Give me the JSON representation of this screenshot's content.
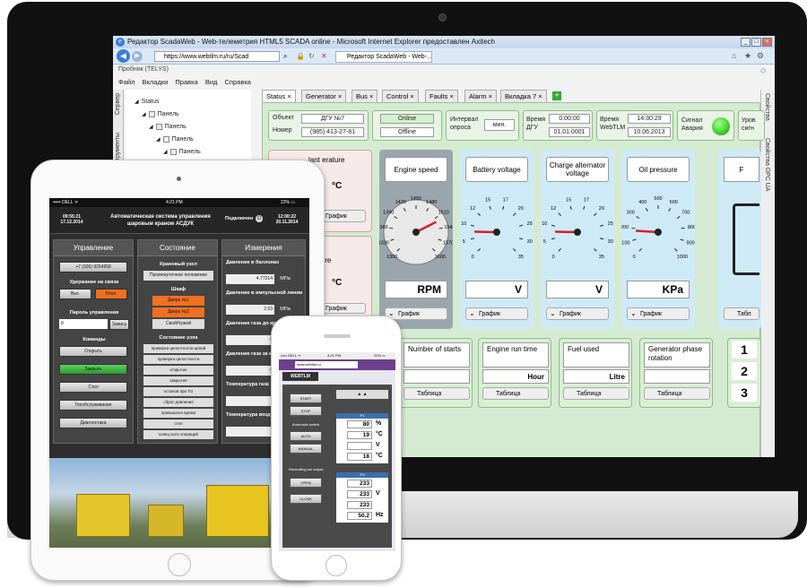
{
  "ie": {
    "title": "Редактор ScadaWeb - Web-телеметрия HTML5 SCADA online - Microsoft Internet Explorer предоставлен Axitech",
    "url": "https://www.webtlm.ru/ru/Scad",
    "tab_title": "Редактор ScadaWeb - Web-...",
    "app_name": "Пробник (TELYS)",
    "menu": [
      "Файл",
      "Вкладки",
      "Правка",
      "Вид",
      "Справка"
    ]
  },
  "sidebar": {
    "tabs": [
      "Сервер",
      "Инструменты"
    ]
  },
  "tree": [
    {
      "label": "Status"
    },
    {
      "label": "Панель"
    },
    {
      "label": "Панель"
    },
    {
      "label": "Панель"
    },
    {
      "label": "Панель"
    }
  ],
  "tabs": [
    {
      "label": "Status",
      "active": true
    },
    {
      "label": "Generator"
    },
    {
      "label": "Bus"
    },
    {
      "label": "Control"
    },
    {
      "label": "Faults"
    },
    {
      "label": "Alarm"
    },
    {
      "label": "Вкладка 7"
    }
  ],
  "right_tabs": [
    "Свойства",
    "Свойства OPC UA"
  ],
  "header": {
    "object_label": "Объект",
    "object_value": "ДГУ №7",
    "number_label": "Номер",
    "number_value": "(985) 413-27-81",
    "online": "Online",
    "offline": "Offline",
    "interval_label": "Интервал опроса",
    "interval_value": "мин.",
    "dgu_time_label": "Время ДГУ",
    "dgu_time": "0:00:00",
    "dgu_date": "01.01.0001",
    "webtlm_label": "Время WebTLM",
    "webtlm_time": "14:30:29",
    "webtlm_date": "10.06.2013",
    "alarm_label": "Сигнал Авария",
    "level_label": "Уров сигн"
  },
  "left_panels": [
    {
      "title": "lant erature",
      "unit": "°C",
      "button": "График"
    },
    {
      "title": "erature",
      "unit": "°C",
      "button": "График"
    }
  ],
  "gauges": [
    {
      "title": "Engine speed",
      "unit": "RPM",
      "button": "График",
      "ticks": [
        "1300",
        "1330",
        "1360",
        "1390",
        "1420",
        "1450",
        "1480",
        "1510",
        "1540",
        "1570",
        "1600"
      ],
      "value": 1520
    },
    {
      "title": "Battery voltage",
      "unit": "V",
      "button": "График",
      "ticks": [
        "0",
        "5",
        "10",
        "12",
        "15",
        "17",
        "20",
        "25",
        "30",
        "35"
      ],
      "value": 6
    },
    {
      "title": "Charge alternator voltage",
      "unit": "V",
      "button": "График",
      "ticks": [
        "0",
        "5",
        "10",
        "12",
        "15",
        "17",
        "20",
        "25",
        "30",
        "35"
      ],
      "value": 6
    },
    {
      "title": "Oil pressure",
      "unit": "KPa",
      "button": "График",
      "ticks": [
        "0",
        "100",
        "200",
        "300",
        "400",
        "500",
        "600",
        "700",
        "800",
        "900",
        "1000"
      ],
      "value": 180
    }
  ],
  "gauge_partial": {
    "title": "F",
    "button": "Табл"
  },
  "counters": [
    {
      "title": "Number of starts",
      "value": "",
      "button": "Таблица"
    },
    {
      "title": "Engine run time",
      "value": "Hour",
      "button": "Таблица"
    },
    {
      "title": "Fuel used",
      "value": "Litre",
      "button": "Таблица"
    },
    {
      "title": "Generator phase rotation",
      "value": "",
      "button": "Таблица"
    }
  ],
  "phase_numbers": [
    "1",
    "2",
    "3"
  ],
  "tablet": {
    "status_left": "••••• DELL ᯤ",
    "status_time": "4:21 PM",
    "status_right": "22% ▭",
    "date_left": "09:55:21 17.12.2014",
    "heading": "Автоматическая система управления шаровым краном АСДУК",
    "connected": "Подключен",
    "date_right": "12:00:22 20.11.2014",
    "col_heads": [
      "Управление",
      "Состояние",
      "Измерения"
    ],
    "phone": "+7 (926) 9254958",
    "hold_label": "Удержание на связи",
    "on": "Вкл.",
    "off": "Откл.",
    "password_label": "Пароль управления",
    "password_value": "0",
    "write": "Запись",
    "commands_label": "Команды",
    "commands": [
      "Открыть",
      "Закрыть",
      "Стоп",
      "Техобслуживание",
      "Диагностика"
    ],
    "valve_label": "Крановый узел",
    "valve_state": "Промежуточное положение",
    "cabinet_label": "Шкаф",
    "door1": "Дверь №1",
    "door2": "Дверь №2",
    "own": "Свой/Чужой",
    "node_label": "Состояние узла",
    "node_items": [
      "проверка целостности цепей",
      "проверка целостности пневмопривода",
      "открытие",
      "закрытие",
      "останов при ТО",
      "сброс давления",
      "превышено время",
      "стоп",
      "конец всех операций"
    ],
    "meas": [
      {
        "label": "Давление в баллонах",
        "value": "4.77214",
        "unit": "MПа"
      },
      {
        "label": "Давление в импульсной линии",
        "value": "2.53",
        "unit": "MПа"
      },
      {
        "label": "Давление газа до крана",
        "value": "0",
        "unit": ""
      },
      {
        "label": "Давление газа за краном",
        "value": "0",
        "unit": ""
      },
      {
        "label": "Температура газа",
        "value": "",
        "unit": ""
      },
      {
        "label": "Температура воздуха",
        "value": "",
        "unit": ""
      }
    ]
  },
  "phone": {
    "status_left": "••••• DELL ᯤ",
    "status_time": "4:21 PM",
    "status_right": "22% ▭",
    "url": "www.webtlm.ru",
    "brand": "WEBTLM",
    "buttons_top": [
      "START",
      "STOP"
    ],
    "auto_label": "Automatic switch",
    "auto_buttons": [
      "AUTO",
      "MANUAL"
    ],
    "gen_label": "Generating set output",
    "gen_buttons": [
      "OPEN",
      "CLOSE"
    ],
    "p1_label": "P1",
    "p1_rows": [
      {
        "value": "80",
        "unit": "%"
      },
      {
        "value": "19",
        "unit": "°C"
      },
      {
        "value": "",
        "unit": "V"
      },
      {
        "value": "18",
        "unit": "°C"
      }
    ],
    "p3_label": "P3",
    "p3_rows": [
      {
        "value": "233",
        "unit": ""
      },
      {
        "value": "233",
        "unit": "V"
      },
      {
        "value": "233",
        "unit": ""
      },
      {
        "value": "50.2",
        "unit": "Hz"
      }
    ]
  },
  "colors": {
    "gauge_bg": "#cfeaf7",
    "panel_green": "#d5ebd1",
    "alarm_green": "#3ccf2a",
    "selected_orange": "#f07020"
  }
}
